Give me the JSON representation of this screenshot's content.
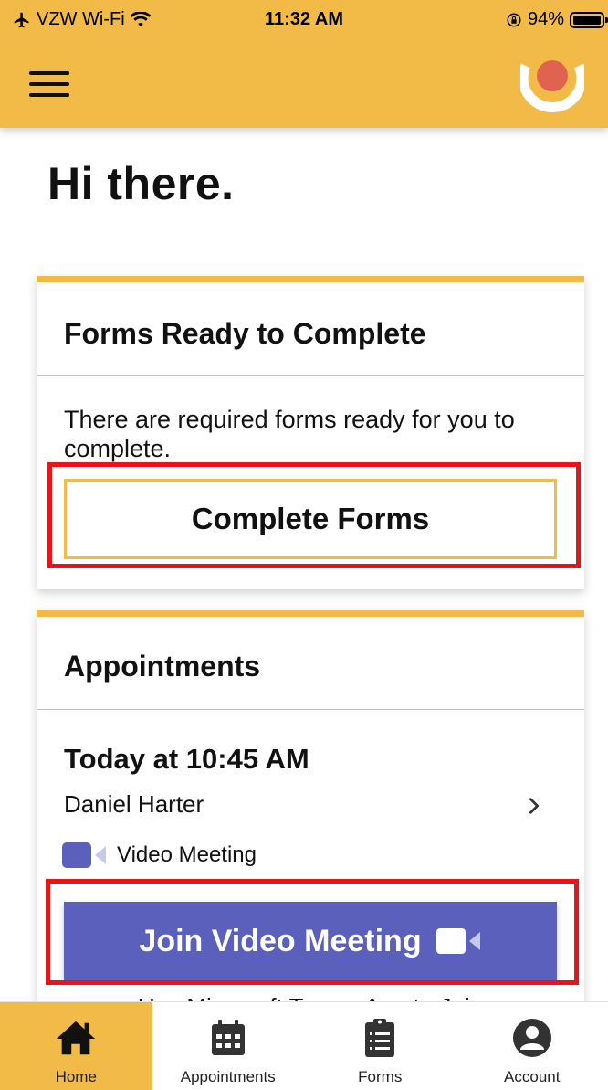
{
  "status_bar": {
    "carrier": "VZW Wi-Fi",
    "time": "11:32 AM",
    "battery": "94%"
  },
  "header": {
    "menu_icon": "hamburger-menu-icon",
    "logo_icon": "app-logo-icon"
  },
  "greeting": "Hi there.",
  "forms_card": {
    "title": "Forms Ready to Complete",
    "message": "There are required forms ready for you to complete.",
    "button_label": "Complete Forms"
  },
  "appointments_card": {
    "title": "Appointments",
    "time": "Today at 10:45 AM",
    "provider": "Daniel Harter",
    "meeting_type": "Video Meeting",
    "join_button_label": "Join Video Meeting",
    "note": "Use Microsoft Teams App to Join"
  },
  "bottom_nav": {
    "items": [
      {
        "label": "Home",
        "icon": "home-icon",
        "active": true
      },
      {
        "label": "Appointments",
        "icon": "calendar-icon",
        "active": false
      },
      {
        "label": "Forms",
        "icon": "clipboard-icon",
        "active": false
      },
      {
        "label": "Account",
        "icon": "account-icon",
        "active": false
      }
    ]
  },
  "colors": {
    "brand_yellow": "#f2bb48",
    "teams_purple": "#5b60bd",
    "highlight_red": "#e8141b",
    "logo_red": "#e0634f"
  }
}
